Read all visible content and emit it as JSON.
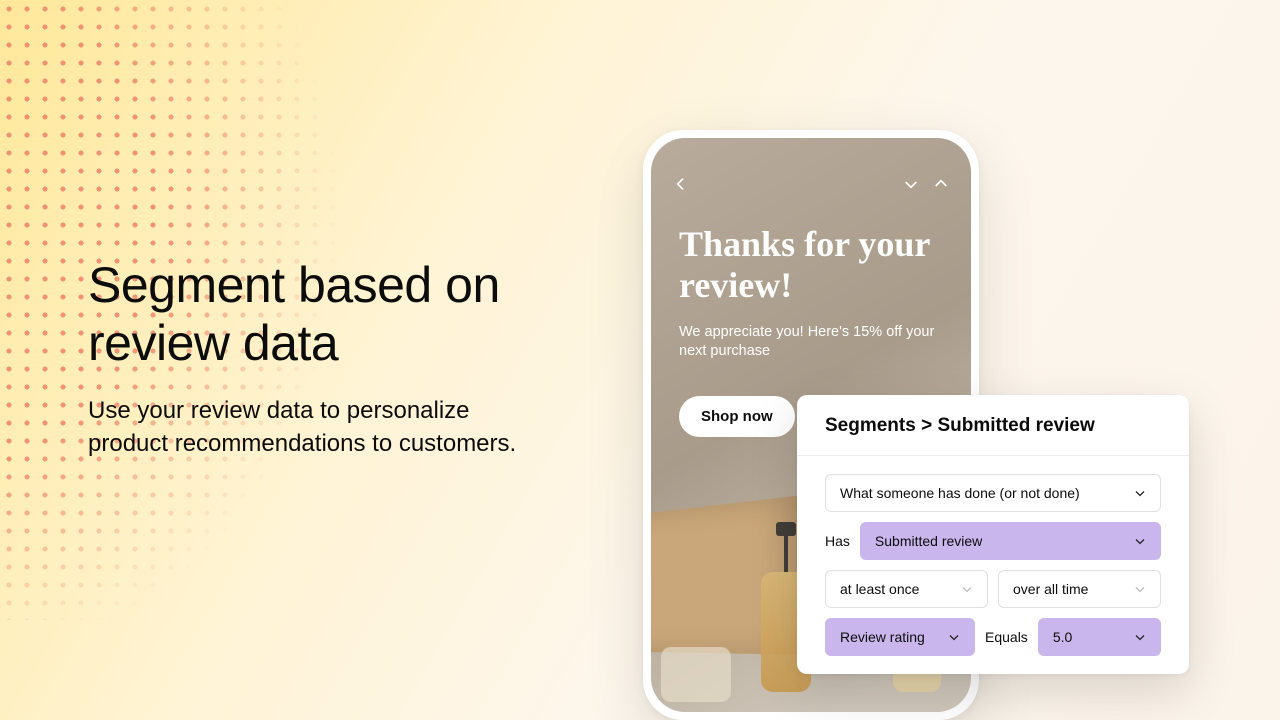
{
  "heading": "Segment based on review data",
  "subheading": "Use your review data to personalize product recommendations to customers.",
  "phone": {
    "title": "Thanks for your review!",
    "subtitle": "We appreciate you! Here's 15% off your next purchase",
    "cta": "Shop now"
  },
  "panel": {
    "breadcrumb": "Segments > Submitted review",
    "condition_type": "What someone has done (or not done)",
    "has_label": "Has",
    "event": "Submitted review",
    "frequency": "at least once",
    "timeframe": "over all time",
    "attribute": "Review rating",
    "operator_label": "Equals",
    "value": "5.0"
  }
}
